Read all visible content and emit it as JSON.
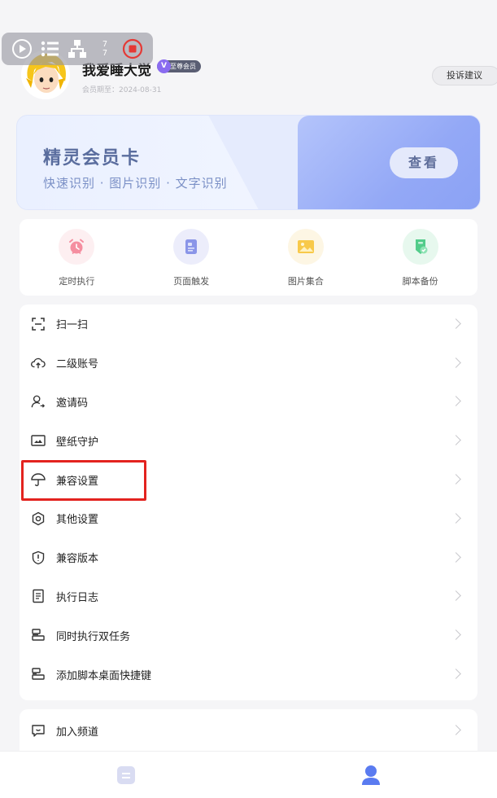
{
  "profile": {
    "username": "我爱睡大觉",
    "vip_badge": "至尊会员",
    "vip_badge_letter": "V",
    "expire": "会员期至：2024-08-31",
    "feedback_button": "投诉建议"
  },
  "overlay": {
    "counter_top": "7",
    "counter_bottom": "7"
  },
  "member_card": {
    "title": "精灵会员卡",
    "subtitle": "快速识别 · 图片识别 · 文字识别",
    "view_button": "查看"
  },
  "tools": [
    {
      "label": "定时执行",
      "icon": "alarm-clock-icon"
    },
    {
      "label": "页面触发",
      "icon": "document-card-icon"
    },
    {
      "label": "图片集合",
      "icon": "image-gallery-icon"
    },
    {
      "label": "脚本备份",
      "icon": "backup-shield-icon"
    }
  ],
  "menu": [
    {
      "label": "扫一扫",
      "icon": "scan-icon"
    },
    {
      "label": "二级账号",
      "icon": "cloud-upload-icon"
    },
    {
      "label": "邀请码",
      "icon": "invite-user-icon"
    },
    {
      "label": "壁纸守护",
      "icon": "wallpaper-icon"
    },
    {
      "label": "兼容设置",
      "icon": "umbrella-icon"
    },
    {
      "label": "其他设置",
      "icon": "settings-hex-icon"
    },
    {
      "label": "兼容版本",
      "icon": "shield-icon"
    },
    {
      "label": "执行日志",
      "icon": "log-icon"
    },
    {
      "label": "同时执行双任务",
      "icon": "dual-task-icon"
    },
    {
      "label": "添加脚本桌面快捷键",
      "icon": "shortcut-icon"
    }
  ],
  "menu_extra": [
    {
      "label": "加入频道",
      "icon": "channel-chat-icon"
    }
  ],
  "colors": {
    "accent": "#8aa1f4",
    "highlight": "#e3231f",
    "tab_active": "#5a7bf0"
  }
}
